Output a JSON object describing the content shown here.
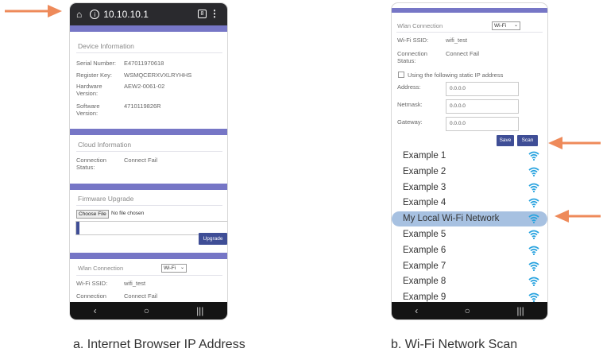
{
  "accent": "#7676c6",
  "arrow_color": "#ee8a5a",
  "left_phone": {
    "url_bar": {
      "home_icon": "home-icon",
      "info_icon": "info-icon",
      "url": "10.10.10.1",
      "tabs_icon": "tabs-icon",
      "menu_icon": "menu-icon"
    },
    "device_info": {
      "title": "Device Information",
      "serial_label": "Serial Number:",
      "serial_value": "E47011970618",
      "register_label": "Register Key:",
      "register_value": "WSMQCERXVXLRYHHS",
      "hardware_label_1": "Hardware",
      "hardware_label_2": "Version:",
      "hardware_value": "AEW2-0061-02",
      "software_label_1": "Software",
      "software_label_2": "Version:",
      "software_value": "4710119826R"
    },
    "cloud_info": {
      "title": "Cloud Information",
      "status_label_1": "Connection",
      "status_label_2": "Status:",
      "status_value": "Connect Fail"
    },
    "firmware": {
      "title": "Firmware Upgrade",
      "choose_label": "Choose File",
      "file_status": "No file chosen",
      "upgrade_label": "Upgrade"
    },
    "wlan": {
      "title": "Wlan Connection",
      "mode": "Wi-Fi",
      "ssid_label": "Wi-Fi SSID:",
      "ssid_value": "wifi_test",
      "status_label": "Connection",
      "status_value": "Connect Fail"
    },
    "nav": {
      "back": "‹",
      "home": "○",
      "recent": "|||"
    }
  },
  "right_phone": {
    "wlan": {
      "title": "Wlan Connection",
      "mode": "Wi-Fi",
      "ssid_label": "Wi-Fi SSID:",
      "ssid_value": "wifi_test",
      "status_label_1": "Connection",
      "status_label_2": "Status:",
      "status_value": "Connect Fail",
      "static_ip_label": "Using the following static IP address",
      "address_label": "Address:",
      "address_value": "0.0.0.0",
      "netmask_label": "Netmask:",
      "netmask_value": "0.0.0.0",
      "gateway_label": "Gateway:",
      "gateway_value": "0.0.0.0",
      "save_label": "Save",
      "scan_label": "Scan"
    },
    "networks": [
      "Example 1",
      "Example 2",
      "Example 3",
      "Example 4",
      "My Local Wi-Fi Network",
      "Example 5",
      "Example 6",
      "Example 7",
      "Example 8",
      "Example 9"
    ],
    "selected_network_index": 4,
    "wifi_icon_color": "#29a3df",
    "nav": {
      "back": "‹",
      "home": "○",
      "recent": "|||"
    }
  },
  "captions": {
    "a": "a.  Internet Browser IP Address",
    "b": "b.  Wi-Fi Network Scan"
  }
}
